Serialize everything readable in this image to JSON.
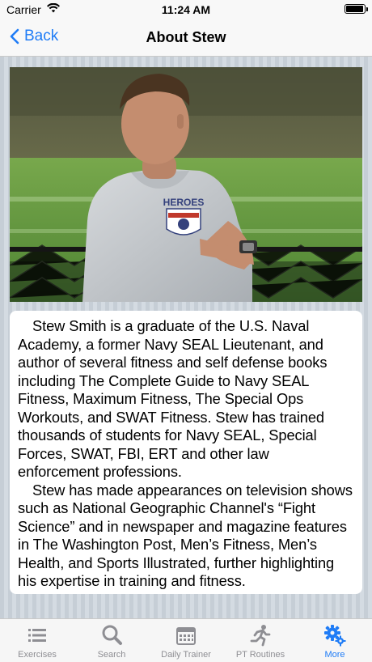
{
  "status": {
    "carrier": "Carrier",
    "time": "11:24 AM",
    "battery_level": 0.95
  },
  "nav": {
    "back_label": "Back",
    "title": "About Stew"
  },
  "bio": {
    "paragraphs": [
      "Stew Smith is a graduate of the U.S. Naval Academy, a former Navy SEAL Lieutenant, and author of several fitness and self defense books including The Complete Guide to Navy SEAL Fitness, Maximum Fitness, The Special Ops Workouts, and SWAT Fitness.  Stew has trained thousands of students for Navy SEAL, Special Forces, SWAT, FBI, ERT and other law enforcement professions.",
      "Stew has made appearances on television shows such as National Geographic Channel's “Fight Science” and in newspaper and magazine features in The Washington Post, Men’s Fitness, Men’s Health, and Sports Illustrated, further highlighting his expertise in training and fitness."
    ]
  },
  "photo": {
    "shirt_text": "HEROES"
  },
  "tabs": [
    {
      "label": "Exercises",
      "icon": "list-icon",
      "active": false
    },
    {
      "label": "Search",
      "icon": "search-icon",
      "active": false
    },
    {
      "label": "Daily Trainer",
      "icon": "calendar-icon",
      "active": false
    },
    {
      "label": "PT Routines",
      "icon": "runner-icon",
      "active": false
    },
    {
      "label": "More",
      "icon": "gears-icon",
      "active": true
    }
  ],
  "colors": {
    "accent": "#1f7cf6",
    "inactive": "#8e8e93"
  }
}
